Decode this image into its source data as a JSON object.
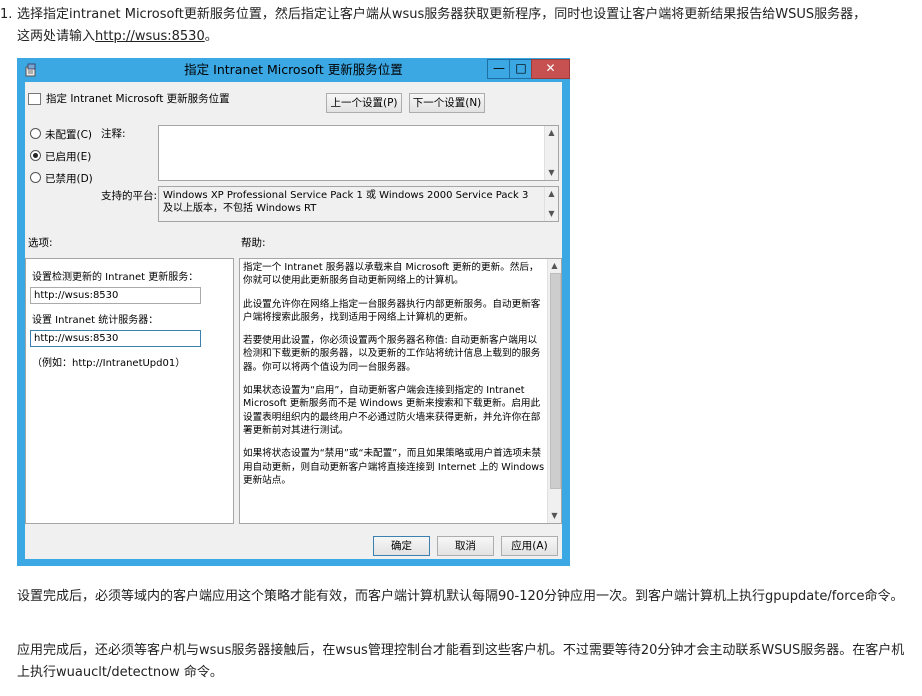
{
  "article": {
    "step_number": "1.",
    "step_text_line1": "选择指定intranet Microsoft更新服务位置，然后指定让客户端从wsus服务器获取更新程序，同时也设置让客户端将更新结果报告给WSUS服务器，",
    "step_text_line2_prefix": "这两处请输入",
    "step_link": "http://wsus:8530",
    "step_text_line2_suffix": "。",
    "para2": "设置完成后，必须等域内的客户端应用这个策略才能有效，而客户端计算机默认每隔90-120分钟应用一次。到客户端计算机上执行gpupdate/force命令。",
    "para3": "应用完成后，还必须等客户机与wsus服务器接触后，在wsus管理控制台才能看到这些客户机。不过需要等待20分钟才会主动联系WSUS服务器。在客户机上执行wuauclt/detectnow 命令。"
  },
  "dialog": {
    "title": "指定 Intranet Microsoft 更新服务位置",
    "window_buttons": {
      "minimize": "—",
      "maximize": "□",
      "close": "✕"
    },
    "header_title": "指定 Intranet Microsoft 更新服务位置",
    "prev_setting_button": "上一个设置(P)",
    "next_setting_button": "下一个设置(N)",
    "radios": [
      {
        "label": "未配置(C)",
        "checked": false
      },
      {
        "label": "已启用(E)",
        "checked": true
      },
      {
        "label": "已禁用(D)",
        "checked": false
      }
    ],
    "comment_label": "注释:",
    "platform_label": "支持的平台:",
    "platform_text": "Windows XP Professional Service Pack 1 或 Windows 2000 Service Pack 3 及以上版本，不包括 Windows RT",
    "options_label": "选项:",
    "help_label": "帮助:",
    "options": {
      "update_service_label": "设置检测更新的 Intranet 更新服务：",
      "update_service_value": "http://wsus:8530",
      "stats_server_label": "设置 Intranet 统计服务器：",
      "stats_server_value": "http://wsus:8530",
      "example_text": "（例如：http://IntranetUpd01）"
    },
    "help_paragraphs": [
      "指定一个 Intranet 服务器以承载来自 Microsoft 更新的更新。然后，你就可以使用此更新服务自动更新网络上的计算机。",
      "此设置允许你在网络上指定一台服务器执行内部更新服务。自动更新客户端将搜索此服务，找到适用于网络上计算机的更新。",
      "若要使用此设置，你必须设置两个服务器名称值: 自动更新客户端用以检测和下载更新的服务器，以及更新的工作站将统计信息上载到的服务器。你可以将两个值设为同一台服务器。",
      "如果状态设置为“启用”，自动更新客户端会连接到指定的 Intranet Microsoft 更新服务而不是 Windows 更新来搜索和下载更新。启用此设置表明组织内的最终用户不必通过防火墙来获得更新，并允许你在部署更新前对其进行测试。",
      "如果将状态设置为“禁用”或“未配置”，而且如果策略或用户首选项未禁用自动更新，则自动更新客户端将直接连接到 Internet 上的 Windows 更新站点。"
    ],
    "ok_button": "确定",
    "cancel_button": "取消",
    "apply_button": "应用(A)",
    "accent_color": "#3ba7e3"
  }
}
